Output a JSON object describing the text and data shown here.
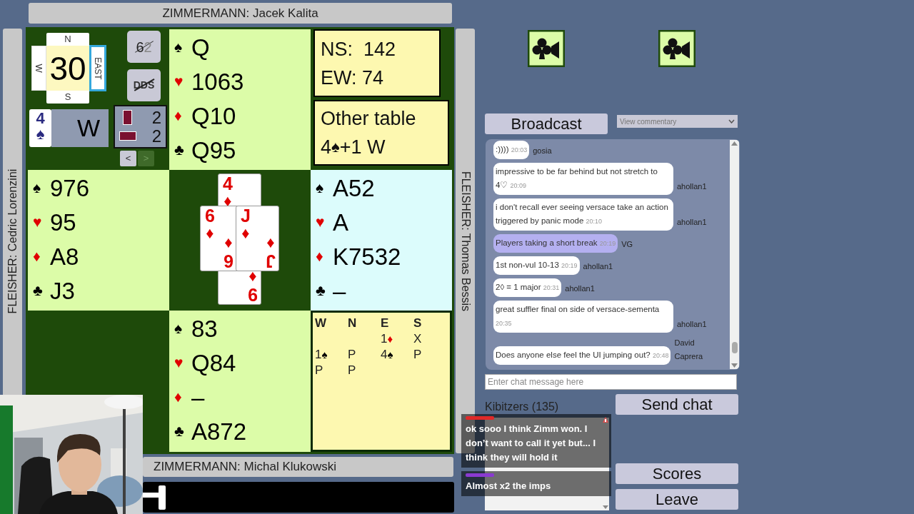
{
  "top_player": {
    "label": "ZIMMERMANN: Jacek Kalita"
  },
  "left_player": {
    "label": "FLEISHER: Cedric Lorenzini"
  },
  "right_player": {
    "label": "FLEISHER: Thomas Bessis"
  },
  "bottom_player": {
    "label": "ZIMMERMANN: Michal Klukowski"
  },
  "board": {
    "number": "30",
    "compass": {
      "west": {
        "label": "W",
        "highlighted": false
      },
      "north": {
        "label": "N",
        "highlighted": false
      },
      "south": {
        "label": "S",
        "highlighted": false
      },
      "east": {
        "label": "EAST",
        "highlighted": true
      }
    }
  },
  "undo_button": {
    "label": "6",
    "faint": "2",
    "crossed": true
  },
  "dds_button": {
    "label": "DDS",
    "crossed": true
  },
  "contract": {
    "level": "4",
    "symbol": "♠",
    "declarer": "W"
  },
  "tricks": [
    {
      "kind": "vertical",
      "count": "2"
    },
    {
      "kind": "horizontal",
      "count": "2"
    }
  ],
  "nav": [
    {
      "label": "<",
      "disabled": false
    },
    {
      "label": ">",
      "disabled": true
    }
  ],
  "hands": {
    "north": {
      "highlighted": false,
      "suits": [
        {
          "symbol": "♠",
          "red": false,
          "cards": "Q"
        },
        {
          "symbol": "♥",
          "red": true,
          "cards": "1063"
        },
        {
          "symbol": "♦",
          "red": true,
          "cards": "Q10"
        },
        {
          "symbol": "♣",
          "red": false,
          "cards": "Q95"
        }
      ]
    },
    "west": {
      "highlighted": false,
      "suits": [
        {
          "symbol": "♠",
          "red": false,
          "cards": "976"
        },
        {
          "symbol": "♥",
          "red": true,
          "cards": "95"
        },
        {
          "symbol": "♦",
          "red": true,
          "cards": "A8"
        },
        {
          "symbol": "♣",
          "red": false,
          "cards": "J3"
        }
      ]
    },
    "east": {
      "highlighted": true,
      "suits": [
        {
          "symbol": "♠",
          "red": false,
          "cards": "A52"
        },
        {
          "symbol": "♥",
          "red": true,
          "cards": "A"
        },
        {
          "symbol": "♦",
          "red": true,
          "cards": "K7532"
        },
        {
          "symbol": "♣",
          "red": false,
          "cards": "–"
        }
      ]
    },
    "south": {
      "highlighted": false,
      "suits": [
        {
          "symbol": "♠",
          "red": false,
          "cards": "83"
        },
        {
          "symbol": "♥",
          "red": true,
          "cards": "Q84"
        },
        {
          "symbol": "♦",
          "red": true,
          "cards": "–"
        },
        {
          "symbol": "♣",
          "red": false,
          "cards": "A872"
        }
      ]
    }
  },
  "trick": {
    "north": {
      "rank": "4",
      "symbol": "♦",
      "red": true
    },
    "south": {
      "bottom_rank": "9",
      "bottom_symbol": "♦",
      "red": true
    },
    "west": {
      "rank": "6",
      "symbol": "♦",
      "bottom_rank": "6",
      "bottom_symbol": "♦",
      "red": true
    },
    "east": {
      "rank": "J",
      "symbol": "♦",
      "bottom_rank": "J",
      "bottom_symbol": "♦",
      "red": true
    }
  },
  "score": {
    "lines": [
      "NS:  142",
      "EW: 74"
    ]
  },
  "other_table": {
    "title": "Other table",
    "level": "4",
    "symbol": "♠",
    "result": "+1 W"
  },
  "bidding": {
    "headers": [
      "W",
      "N",
      "E",
      "S"
    ],
    "rows": [
      [
        null,
        null,
        {
          "text": "1",
          "symbol": "♦",
          "red": true
        },
        {
          "text": "X"
        }
      ],
      [
        {
          "text": "1",
          "symbol": "♠",
          "red": false
        },
        {
          "text": "P"
        },
        {
          "text": "4",
          "symbol": "♠",
          "red": false
        },
        {
          "text": "P"
        }
      ],
      [
        {
          "text": "P"
        },
        {
          "text": "P"
        },
        null,
        null
      ]
    ]
  },
  "broadcast_button": {
    "label": "Broadcast"
  },
  "commentary_select": {
    "value": "View commentary"
  },
  "chat": {
    "messages": [
      {
        "kind": "normal",
        "text": ":))))",
        "time": "20:03",
        "author": "gosia"
      },
      {
        "kind": "normal",
        "text": "impressive to be far behind but not stretch to 4♡",
        "time": "20:09",
        "author": "ahollan1"
      },
      {
        "kind": "normal",
        "text": "i don't recall ever seeing versace take an action triggered by panic mode",
        "time": "20:10",
        "author": "ahollan1"
      },
      {
        "kind": "commentary",
        "text": "Players taking a short break",
        "time": "20:19",
        "author": "VG"
      },
      {
        "kind": "normal",
        "text": "1st non-vul 10-13",
        "time": "20:19",
        "author": "ahollan1"
      },
      {
        "kind": "normal",
        "text": "2◊ = 1 major",
        "time": "20:31",
        "author": "ahollan1"
      },
      {
        "kind": "normal",
        "text": "great suffler final on side of versace-sementa",
        "time": "20:35",
        "author": "ahollan1"
      },
      {
        "kind": "normal",
        "text": "Does anyone else feel the UI jumping out?",
        "time": "20:48",
        "author": "David Caprera"
      }
    ]
  },
  "chat_input": {
    "placeholder": "Enter chat message here"
  },
  "send_button": {
    "label": "Send chat"
  },
  "kibitzers": {
    "title": "Kibitzers (135)"
  },
  "scores_button": {
    "label": "Scores"
  },
  "leave_button": {
    "label": "Leave"
  },
  "stream_chat": [
    {
      "color": "#e02828",
      "text": "ok sooo I think Zimm won. I don’t want to call it yet but... I think they will hold it",
      "badge": true
    },
    {
      "color": "#8a3ad0",
      "text": "Almost x2 the imps",
      "badge": false
    }
  ]
}
